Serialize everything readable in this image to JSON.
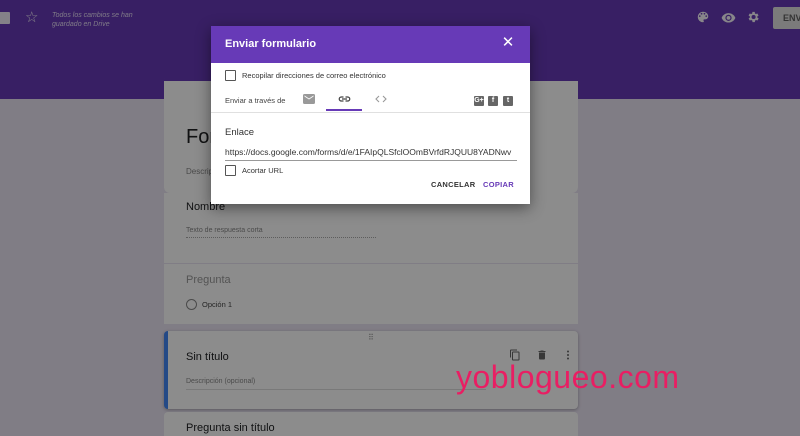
{
  "topbar": {
    "saved_text": "Todos los cambios se han guardado en Drive",
    "send_label": "ENVI",
    "icons": [
      "folder-icon",
      "star-icon",
      "palette-icon",
      "eye-icon",
      "gear-icon"
    ]
  },
  "form": {
    "title": "Forr",
    "description": "Descrip",
    "questions": [
      {
        "title": "Nombre",
        "hint": "Texto de respuesta corta"
      },
      {
        "title": "Pregunta",
        "option": "Opción 1"
      }
    ],
    "active_question": {
      "title": "Sin título",
      "description": "Descripción (opcional)",
      "drag_handle": "⠿"
    },
    "next_question": {
      "title": "Pregunta sin título"
    }
  },
  "dialog": {
    "title": "Enviar formulario",
    "collect_emails_label": "Recopilar direcciones de correo electrónico",
    "send_via_label": "Enviar a través de",
    "tabs": [
      "email",
      "link",
      "embed"
    ],
    "active_tab": "link",
    "social": {
      "gplus": "G+",
      "facebook": "f",
      "twitter": "t"
    },
    "link_label": "Enlace",
    "link_value": "https://docs.google.com/forms/d/e/1FAIpQLSfclOOmBVrfdRJQUU8YADNwv",
    "shorten_label": "Acortar URL",
    "cancel_label": "CANCELAR",
    "copy_label": "COPIAR"
  },
  "watermark": "yoblogueo.com",
  "colors": {
    "primary": "#673ab7",
    "accent_blue": "#4285f4",
    "watermark": "#e91e63"
  }
}
